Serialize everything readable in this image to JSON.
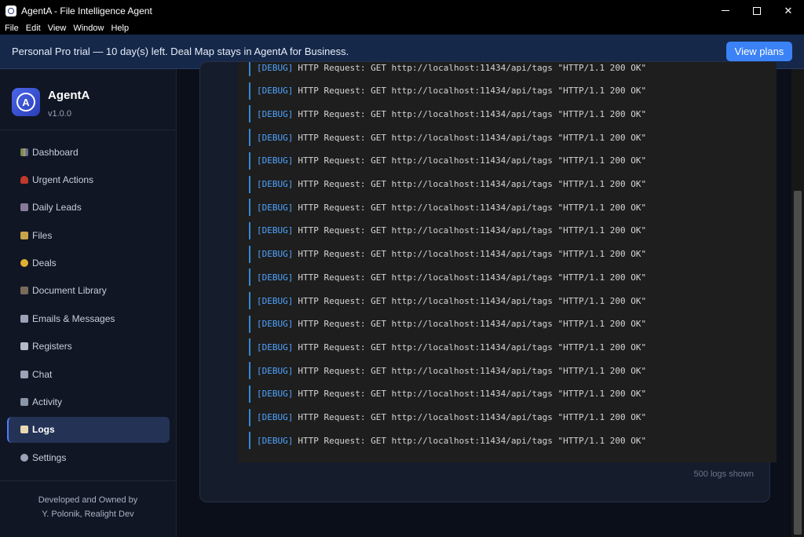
{
  "window": {
    "title": "AgentA - File Intelligence Agent",
    "minimize": "",
    "maximize": "",
    "close": "✕"
  },
  "menu": [
    "File",
    "Edit",
    "View",
    "Window",
    "Help"
  ],
  "banner": {
    "text": "Personal Pro trial — 10 day(s) left. Deal Map stays in AgentA for Business.",
    "button": "View plans"
  },
  "brand": {
    "name": "AgentA",
    "version": "v1.0.0",
    "logo_letter": "A"
  },
  "nav": [
    {
      "label": "Dashboard",
      "icon": "dashboard-icon"
    },
    {
      "label": "Urgent Actions",
      "icon": "urgent-icon"
    },
    {
      "label": "Daily Leads",
      "icon": "leads-icon"
    },
    {
      "label": "Files",
      "icon": "folder-icon"
    },
    {
      "label": "Deals",
      "icon": "deals-icon"
    },
    {
      "label": "Document Library",
      "icon": "library-icon"
    },
    {
      "label": "Emails & Messages",
      "icon": "email-icon"
    },
    {
      "label": "Registers",
      "icon": "registers-icon"
    },
    {
      "label": "Chat",
      "icon": "chat-icon"
    },
    {
      "label": "Activity",
      "icon": "activity-icon"
    },
    {
      "label": "Logs",
      "icon": "logs-icon",
      "active": true
    },
    {
      "label": "Settings",
      "icon": "settings-icon"
    }
  ],
  "footer": {
    "line1": "Developed and Owned by",
    "line2": "Y. Polonik, Realight Dev"
  },
  "logs": {
    "level": "[DEBUG]",
    "message": "HTTP Request: GET http://localhost:11434/api/tags \"HTTP/1.1 200 OK\"",
    "visible_lines": 17,
    "count_label": "500 logs shown"
  }
}
